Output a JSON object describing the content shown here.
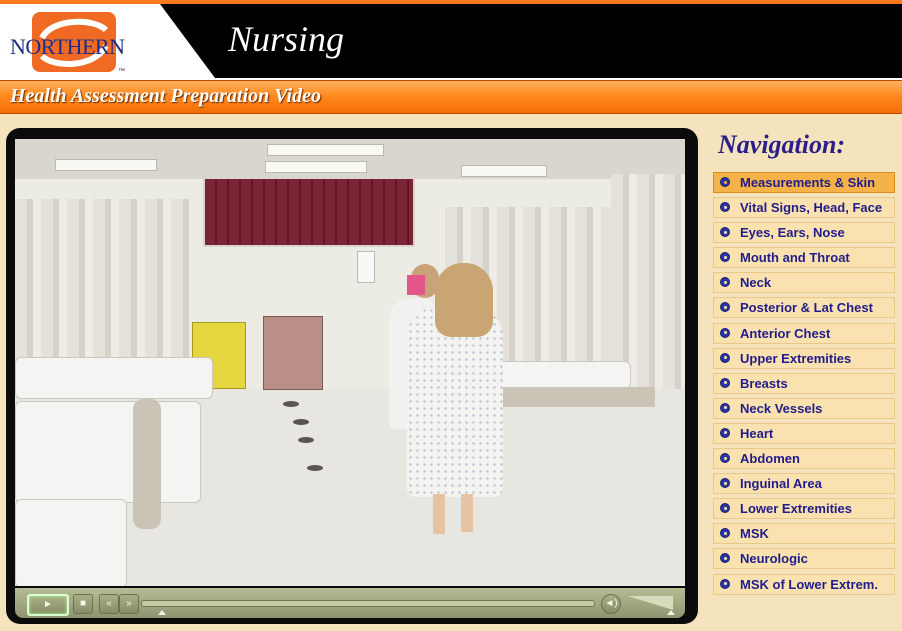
{
  "header": {
    "logo_text": "NORTHERN",
    "logo_tm": "™",
    "title": "Nursing",
    "subtitle": "Health Assessment Preparation Video"
  },
  "colors": {
    "header_bg": "#000000",
    "accent_orange": "#f36d05",
    "nav_text": "#221c8a",
    "nav_active_bg": "#f4b248",
    "page_bg": "#f5e3bd"
  },
  "player": {
    "controls": {
      "play_icon": "play-icon",
      "stop_icon": "stop-icon",
      "rewind_icon": "rewind-icon",
      "fast_forward_icon": "fast-forward-icon",
      "volume_icon": "volume-icon"
    },
    "progress": 0.0
  },
  "navigation": {
    "title": "Navigation:",
    "items": [
      {
        "label": "Measurements & Skin",
        "active": true
      },
      {
        "label": "Vital Signs, Head, Face",
        "active": false
      },
      {
        "label": "Eyes, Ears, Nose",
        "active": false
      },
      {
        "label": "Mouth and Throat",
        "active": false
      },
      {
        "label": "Neck",
        "active": false
      },
      {
        "label": "Posterior & Lat Chest",
        "active": false
      },
      {
        "label": "Anterior Chest",
        "active": false
      },
      {
        "label": "Upper Extremities",
        "active": false
      },
      {
        "label": "Breasts",
        "active": false
      },
      {
        "label": "Neck Vessels",
        "active": false
      },
      {
        "label": "Heart",
        "active": false
      },
      {
        "label": "Abdomen",
        "active": false
      },
      {
        "label": "Inguinal Area",
        "active": false
      },
      {
        "label": "Lower Extremities",
        "active": false
      },
      {
        "label": "MSK",
        "active": false
      },
      {
        "label": "Neurologic",
        "active": false
      },
      {
        "label": "MSK of Lower Extrem.",
        "active": false
      }
    ]
  }
}
